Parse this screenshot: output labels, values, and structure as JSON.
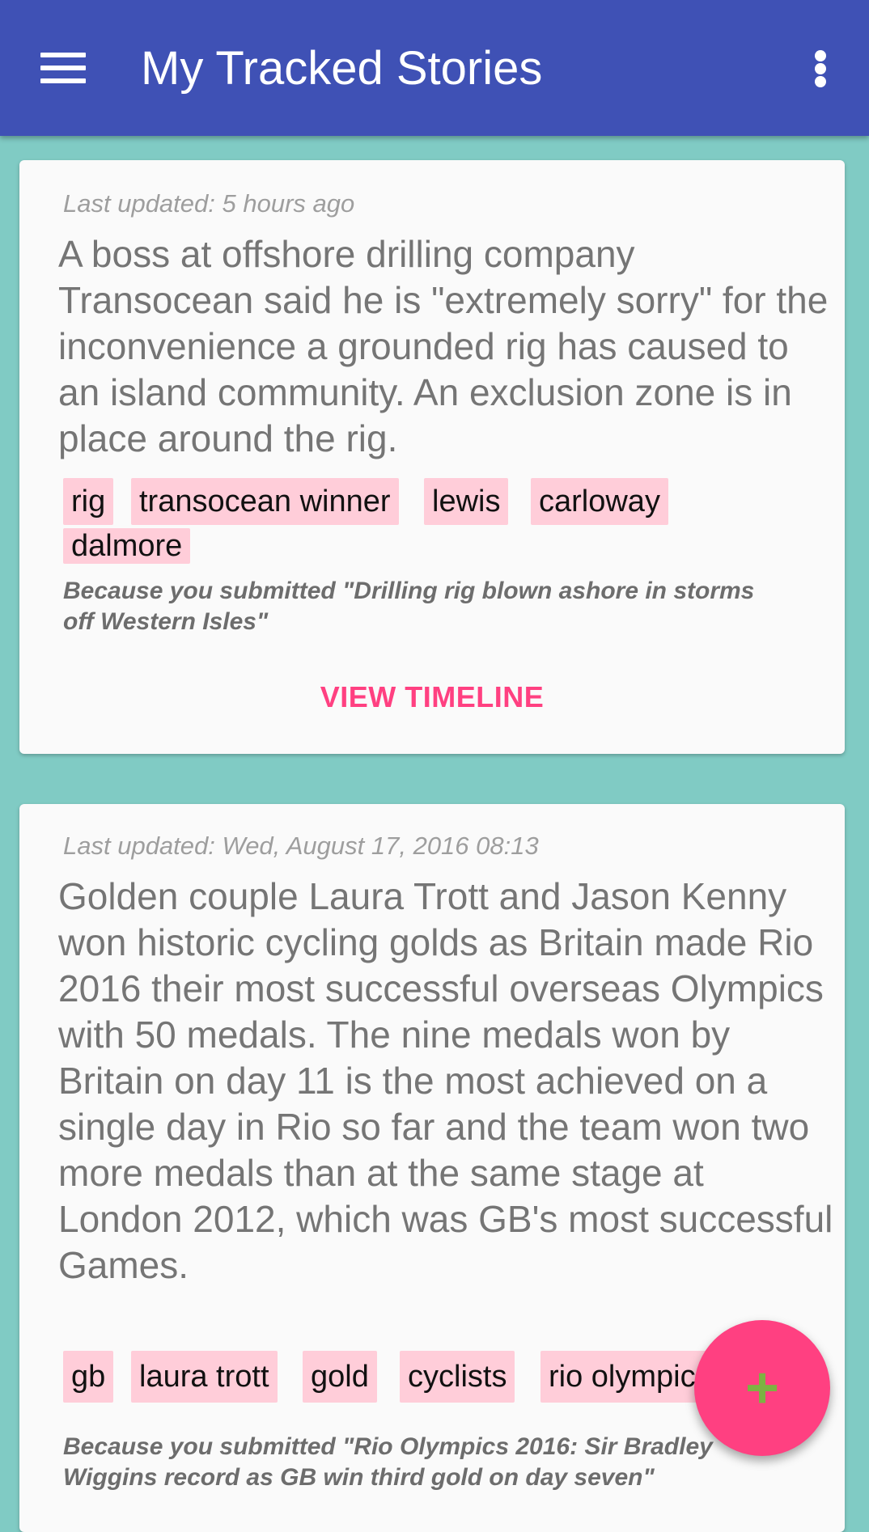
{
  "app_bar": {
    "title": "My Tracked Stories",
    "menu_icon": "hamburger-menu-icon",
    "overflow_icon": "more-vert-icon"
  },
  "colors": {
    "app_bar": "#3f51b5",
    "background": "#80cbc4",
    "accent": "#ff4081",
    "tag_background": "#ffcdd9",
    "fab_icon": "#7cb342"
  },
  "stories": [
    {
      "updated": "Last updated: 5 hours ago",
      "summary": "A boss at offshore drilling company Transocean said he is \"extremely sorry\" for the inconvenience a grounded rig has caused to an island community. An exclusion zone is in place around the rig.",
      "tags": [
        "rig",
        "transocean winner",
        "lewis",
        "carloway",
        "dalmore"
      ],
      "because": "Because you submitted \"Drilling rig blown ashore in storms off Western Isles\"",
      "action": "VIEW TIMELINE"
    },
    {
      "updated": "Last updated: Wed, August 17, 2016 08:13",
      "summary": "Golden couple Laura Trott and Jason Kenny won historic cycling golds as Britain made Rio 2016 their most successful overseas Olympics with 50 medals. The nine medals won by Britain on day 11 is the most achieved on a single day in Rio so far and the team won two more medals than at the same stage at London 2012, which was GB's most successful Games.",
      "tags": [
        "gb",
        "laura trott",
        "gold",
        "cyclists",
        "rio olympics"
      ],
      "because": "Because you submitted \"Rio Olympics 2016: Sir Bradley Wiggins record as GB win third gold on day seven\""
    }
  ],
  "fab": {
    "icon": "add-icon",
    "symbol": "+"
  }
}
